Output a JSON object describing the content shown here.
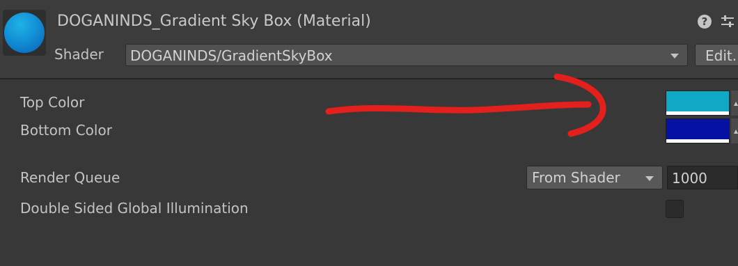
{
  "header": {
    "title": "DOGANINDS_Gradient Sky Box (Material)",
    "shader_label": "Shader",
    "shader_value": "DOGANINDS/GradientSkyBox",
    "edit_label": "Edit..."
  },
  "properties": {
    "top_color": {
      "label": "Top Color",
      "color": "#0fa8c5"
    },
    "bottom_color": {
      "label": "Bottom Color",
      "color": "#0411a3"
    }
  },
  "render_queue": {
    "label": "Render Queue",
    "mode": "From Shader",
    "value": "1000"
  },
  "double_sided_gi": {
    "label": "Double Sided Global Illumination",
    "checked": false
  },
  "annotation": {
    "color": "#e3201b"
  },
  "icons": [
    "material-preview-icon",
    "help-icon",
    "settings-icon",
    "chevron-down-icon"
  ]
}
